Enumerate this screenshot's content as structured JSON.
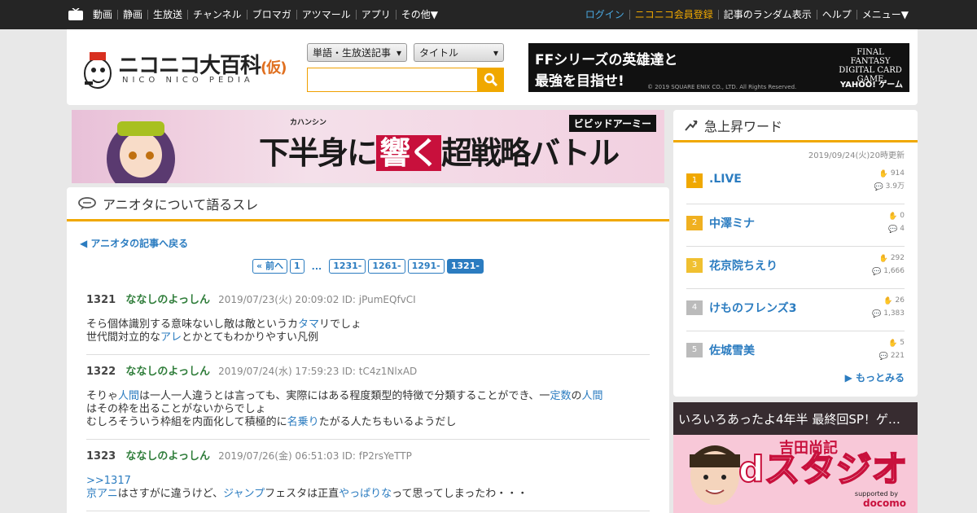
{
  "topbar": {
    "left_links": [
      "動画",
      "静画",
      "生放送",
      "チャンネル",
      "ブロマガ",
      "アツマール",
      "アプリ",
      "その他▼"
    ],
    "login": "ログイン",
    "register": "ニコニコ会員登録",
    "right_links": [
      "記事のランダム表示",
      "ヘルプ",
      "メニュー▼"
    ]
  },
  "header": {
    "logo_text": "ニコニコ大百科",
    "logo_badge": "(仮)",
    "logo_sub": "NICO NICO PEDIA",
    "search_type": "単語・生放送記事",
    "search_target": "タイトル",
    "search_value": "",
    "ad": {
      "line1": "FFシリーズの英雄達と",
      "line2": "最強を目指せ!",
      "logo": "FINAL FANTASY DIGITAL CARD GAME",
      "sponsor": "YAHOO! ゲーム",
      "copyright": "© 2019 SQUARE ENIX CO., LTD. All Rights Reserved."
    }
  },
  "banner": {
    "ruby": "カハンシン",
    "text_a": "下半身に",
    "text_b": "響く",
    "text_c": "超戦略バトル",
    "brand": "ビビッドアーミー"
  },
  "main": {
    "thread_title": "アニオタについて語るスレ",
    "back_link": "◀ アニオタの記事へ戻る",
    "pager": {
      "prev": "« 前へ",
      "first": "1",
      "dots": "...",
      "pages": [
        "1231-",
        "1261-",
        "1291-"
      ],
      "current": "1321-"
    },
    "posts": [
      {
        "num": "1321",
        "name": "ななしのよっしん",
        "date": "2019/07/23(火) 20:09:02 ID: jPumEQfvCI",
        "l1a": "そら個体識別する意味ないし敵は敵というカ",
        "l1link": "タマ",
        "l1b": "リでしょ",
        "l2a": "世代間対立的な",
        "l2link": "アレ",
        "l2b": "とかとてもわかりやすい凡例"
      },
      {
        "num": "1322",
        "name": "ななしのよっしん",
        "date": "2019/07/24(水) 17:59:23 ID: tC4z1NlxAD",
        "l1a": "そりゃ",
        "l1link": "人間",
        "l1b": "は一人一人違うとは言っても、実際にはある程度類型的特徴で分類することができ、一",
        "l1link2": "定数",
        "l1c": "の",
        "l1link3": "人間",
        "l2": "はその枠を出ることがないからでしょ",
        "l3a": "むしろそういう枠組を内面化して積極的に",
        "l3link": "名乗り",
        "l3b": "たがる人たちもいるようだし"
      },
      {
        "num": "1323",
        "name": "ななしのよっしん",
        "date": "2019/07/26(金) 06:51:03 ID: fP2rsYeTTP",
        "anchor": ">>1317",
        "l2link": "京アニ",
        "l2a": "はさすがに違うけど、",
        "l2link2": "ジャンプ",
        "l2b": "フェスタは正直",
        "l2link3": "やっぱりな",
        "l2c": "って思ってしまったわ・・・"
      }
    ]
  },
  "sidebar": {
    "title": "急上昇ワード",
    "updated": "2019/09/24(火)20時更新",
    "items": [
      {
        "rank": "1",
        "name": ".LIVE",
        "likes": "914",
        "comments": "3.9万",
        "color": "#f0a800"
      },
      {
        "rank": "2",
        "name": "中澤ミナ",
        "likes": "0",
        "comments": "4",
        "color": "#f0b020"
      },
      {
        "rank": "3",
        "name": "花京院ちえり",
        "likes": "292",
        "comments": "1,666",
        "color": "#f0c030"
      },
      {
        "rank": "4",
        "name": "けものフレンズ3",
        "likes": "26",
        "comments": "1,383",
        "color": "#bbbbbb"
      },
      {
        "rank": "5",
        "name": "佐城雪美",
        "likes": "5",
        "comments": "221",
        "color": "#bbbbbb"
      }
    ],
    "more": "▶ もっとみる"
  },
  "side_ad": {
    "caption": "いろいろあったよ4年半 最終回SP！ゲ…",
    "name": "吉田尚記",
    "big": "dスタジオ",
    "supported": "supported by",
    "sponsor": "docomo"
  },
  "colors": {
    "accent": "#f0a800",
    "link": "#2b7cc0",
    "name_green": "#2f7d3a",
    "topbar": "#252525"
  }
}
